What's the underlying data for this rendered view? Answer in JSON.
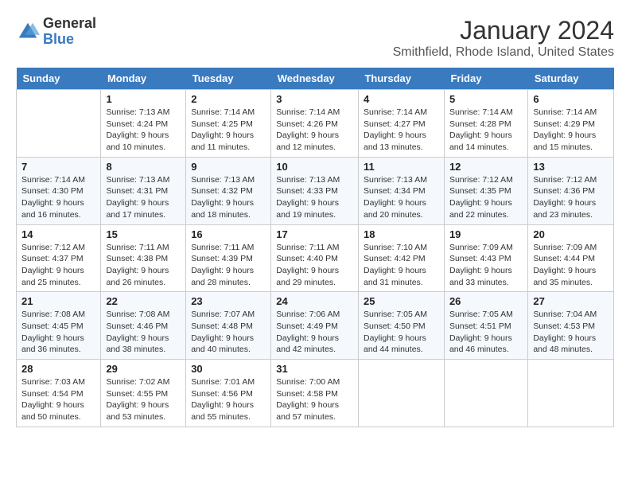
{
  "header": {
    "logo_general": "General",
    "logo_blue": "Blue",
    "month_title": "January 2024",
    "subtitle": "Smithfield, Rhode Island, United States"
  },
  "days_of_week": [
    "Sunday",
    "Monday",
    "Tuesday",
    "Wednesday",
    "Thursday",
    "Friday",
    "Saturday"
  ],
  "weeks": [
    [
      {
        "day": "",
        "sunrise": "",
        "sunset": "",
        "daylight": ""
      },
      {
        "day": "1",
        "sunrise": "Sunrise: 7:13 AM",
        "sunset": "Sunset: 4:24 PM",
        "daylight": "Daylight: 9 hours and 10 minutes."
      },
      {
        "day": "2",
        "sunrise": "Sunrise: 7:14 AM",
        "sunset": "Sunset: 4:25 PM",
        "daylight": "Daylight: 9 hours and 11 minutes."
      },
      {
        "day": "3",
        "sunrise": "Sunrise: 7:14 AM",
        "sunset": "Sunset: 4:26 PM",
        "daylight": "Daylight: 9 hours and 12 minutes."
      },
      {
        "day": "4",
        "sunrise": "Sunrise: 7:14 AM",
        "sunset": "Sunset: 4:27 PM",
        "daylight": "Daylight: 9 hours and 13 minutes."
      },
      {
        "day": "5",
        "sunrise": "Sunrise: 7:14 AM",
        "sunset": "Sunset: 4:28 PM",
        "daylight": "Daylight: 9 hours and 14 minutes."
      },
      {
        "day": "6",
        "sunrise": "Sunrise: 7:14 AM",
        "sunset": "Sunset: 4:29 PM",
        "daylight": "Daylight: 9 hours and 15 minutes."
      }
    ],
    [
      {
        "day": "7",
        "sunrise": "Sunrise: 7:14 AM",
        "sunset": "Sunset: 4:30 PM",
        "daylight": "Daylight: 9 hours and 16 minutes."
      },
      {
        "day": "8",
        "sunrise": "Sunrise: 7:13 AM",
        "sunset": "Sunset: 4:31 PM",
        "daylight": "Daylight: 9 hours and 17 minutes."
      },
      {
        "day": "9",
        "sunrise": "Sunrise: 7:13 AM",
        "sunset": "Sunset: 4:32 PM",
        "daylight": "Daylight: 9 hours and 18 minutes."
      },
      {
        "day": "10",
        "sunrise": "Sunrise: 7:13 AM",
        "sunset": "Sunset: 4:33 PM",
        "daylight": "Daylight: 9 hours and 19 minutes."
      },
      {
        "day": "11",
        "sunrise": "Sunrise: 7:13 AM",
        "sunset": "Sunset: 4:34 PM",
        "daylight": "Daylight: 9 hours and 20 minutes."
      },
      {
        "day": "12",
        "sunrise": "Sunrise: 7:12 AM",
        "sunset": "Sunset: 4:35 PM",
        "daylight": "Daylight: 9 hours and 22 minutes."
      },
      {
        "day": "13",
        "sunrise": "Sunrise: 7:12 AM",
        "sunset": "Sunset: 4:36 PM",
        "daylight": "Daylight: 9 hours and 23 minutes."
      }
    ],
    [
      {
        "day": "14",
        "sunrise": "Sunrise: 7:12 AM",
        "sunset": "Sunset: 4:37 PM",
        "daylight": "Daylight: 9 hours and 25 minutes."
      },
      {
        "day": "15",
        "sunrise": "Sunrise: 7:11 AM",
        "sunset": "Sunset: 4:38 PM",
        "daylight": "Daylight: 9 hours and 26 minutes."
      },
      {
        "day": "16",
        "sunrise": "Sunrise: 7:11 AM",
        "sunset": "Sunset: 4:39 PM",
        "daylight": "Daylight: 9 hours and 28 minutes."
      },
      {
        "day": "17",
        "sunrise": "Sunrise: 7:11 AM",
        "sunset": "Sunset: 4:40 PM",
        "daylight": "Daylight: 9 hours and 29 minutes."
      },
      {
        "day": "18",
        "sunrise": "Sunrise: 7:10 AM",
        "sunset": "Sunset: 4:42 PM",
        "daylight": "Daylight: 9 hours and 31 minutes."
      },
      {
        "day": "19",
        "sunrise": "Sunrise: 7:09 AM",
        "sunset": "Sunset: 4:43 PM",
        "daylight": "Daylight: 9 hours and 33 minutes."
      },
      {
        "day": "20",
        "sunrise": "Sunrise: 7:09 AM",
        "sunset": "Sunset: 4:44 PM",
        "daylight": "Daylight: 9 hours and 35 minutes."
      }
    ],
    [
      {
        "day": "21",
        "sunrise": "Sunrise: 7:08 AM",
        "sunset": "Sunset: 4:45 PM",
        "daylight": "Daylight: 9 hours and 36 minutes."
      },
      {
        "day": "22",
        "sunrise": "Sunrise: 7:08 AM",
        "sunset": "Sunset: 4:46 PM",
        "daylight": "Daylight: 9 hours and 38 minutes."
      },
      {
        "day": "23",
        "sunrise": "Sunrise: 7:07 AM",
        "sunset": "Sunset: 4:48 PM",
        "daylight": "Daylight: 9 hours and 40 minutes."
      },
      {
        "day": "24",
        "sunrise": "Sunrise: 7:06 AM",
        "sunset": "Sunset: 4:49 PM",
        "daylight": "Daylight: 9 hours and 42 minutes."
      },
      {
        "day": "25",
        "sunrise": "Sunrise: 7:05 AM",
        "sunset": "Sunset: 4:50 PM",
        "daylight": "Daylight: 9 hours and 44 minutes."
      },
      {
        "day": "26",
        "sunrise": "Sunrise: 7:05 AM",
        "sunset": "Sunset: 4:51 PM",
        "daylight": "Daylight: 9 hours and 46 minutes."
      },
      {
        "day": "27",
        "sunrise": "Sunrise: 7:04 AM",
        "sunset": "Sunset: 4:53 PM",
        "daylight": "Daylight: 9 hours and 48 minutes."
      }
    ],
    [
      {
        "day": "28",
        "sunrise": "Sunrise: 7:03 AM",
        "sunset": "Sunset: 4:54 PM",
        "daylight": "Daylight: 9 hours and 50 minutes."
      },
      {
        "day": "29",
        "sunrise": "Sunrise: 7:02 AM",
        "sunset": "Sunset: 4:55 PM",
        "daylight": "Daylight: 9 hours and 53 minutes."
      },
      {
        "day": "30",
        "sunrise": "Sunrise: 7:01 AM",
        "sunset": "Sunset: 4:56 PM",
        "daylight": "Daylight: 9 hours and 55 minutes."
      },
      {
        "day": "31",
        "sunrise": "Sunrise: 7:00 AM",
        "sunset": "Sunset: 4:58 PM",
        "daylight": "Daylight: 9 hours and 57 minutes."
      },
      {
        "day": "",
        "sunrise": "",
        "sunset": "",
        "daylight": ""
      },
      {
        "day": "",
        "sunrise": "",
        "sunset": "",
        "daylight": ""
      },
      {
        "day": "",
        "sunrise": "",
        "sunset": "",
        "daylight": ""
      }
    ]
  ]
}
